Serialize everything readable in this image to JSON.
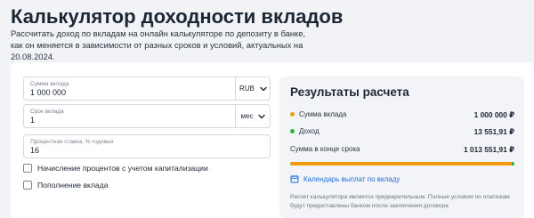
{
  "header": {
    "title": "Калькулятор доходности вкладов",
    "description": "Рассчитать доход по вкладам на онлайн калькуляторе по депозиту в банке, как он меняется в зависимости от разных сроков и условий, актуальных на 20.08.2024."
  },
  "form": {
    "amount": {
      "label": "Сумма вклада",
      "value": "1 000 000",
      "currency": "RUB"
    },
    "term": {
      "label": "Срок вклада",
      "value": "1",
      "unit": "мес"
    },
    "rate": {
      "label": "Процентная ставка, % годовых",
      "value": "16"
    },
    "capitalization": {
      "label": "Начисление процентов с учетом капитализации",
      "checked": false
    },
    "replenishment": {
      "label": "Пополнение вклада",
      "checked": false
    }
  },
  "results": {
    "title": "Результаты расчета",
    "deposit": {
      "label": "Сумма вклада",
      "value": "1 000 000 ₽",
      "color": "#f39c12"
    },
    "income": {
      "label": "Доход",
      "value": "13 551,91 ₽",
      "color": "#2fb344"
    },
    "total": {
      "label": "Сумма в конце срока",
      "value": "1 013 551,91 ₽"
    },
    "income_share": 0.0134,
    "calendar_link": "Календарь выплат по вкладу",
    "note": "Расчет калькулятора является предварительным. Полные условия по платежам будут предоставлены банком после заключения договора"
  },
  "icons": {
    "chevron": "chevron-down-icon",
    "calendar": "calendar-icon"
  }
}
